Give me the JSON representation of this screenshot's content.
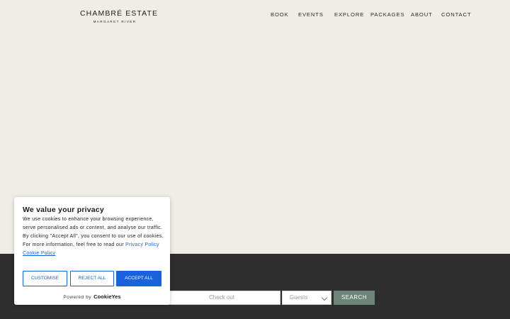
{
  "brand": {
    "title": "CHAMBRÉ ESTATE",
    "subtitle": "MARGARET RIVER"
  },
  "nav": {
    "items": [
      {
        "label": "BOOK"
      },
      {
        "label": "EVENTS"
      },
      {
        "label": "EXPLORE"
      },
      {
        "label": "PACKAGES"
      },
      {
        "label": "ABOUT"
      },
      {
        "label": "CONTACT"
      }
    ]
  },
  "booking": {
    "checkout_placeholder": "Check out",
    "guests_label": "Guests",
    "search_label": "SEARCH"
  },
  "cookie": {
    "title": "We value your privacy",
    "body": "We use cookies to enhance your browsing experience, serve personalised ads or content, and analyse our traffic. By clicking \"Accept All\", you consent to our use of cookies. For more information, feel free to read our ",
    "privacy_link": "Privacy Policy",
    "cookie_link": "Cookie Policy",
    "customise_label": "CUSTOMISE",
    "reject_label": "REJECT ALL",
    "accept_label": "ACCEPT ALL",
    "powered_by": "Powered by",
    "powered_brand": "CookieYes",
    "accent_color": "#1863dc"
  },
  "colors": {
    "page_bg": "#f0ede8",
    "band_bg": "#2e2e2e",
    "search_button": "#6b8579"
  }
}
